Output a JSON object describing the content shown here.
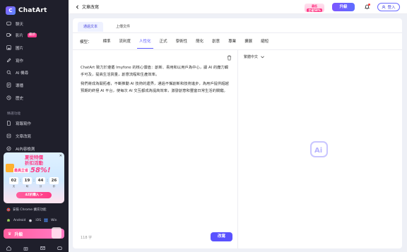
{
  "sidebar": {
    "brand": "ChatArt",
    "nav": [
      {
        "label": "聊天",
        "icon": "chat-icon"
      },
      {
        "label": "影片",
        "icon": "video-icon",
        "badge": "最新"
      },
      {
        "label": "圖片",
        "icon": "image-icon"
      },
      {
        "label": "寫作",
        "icon": "pen-icon"
      },
      {
        "label": "AI 機尋",
        "icon": "ai-search-icon"
      },
      {
        "label": "導播",
        "icon": "broadcast-icon"
      },
      {
        "label": "歷史",
        "icon": "history-icon"
      }
    ],
    "section_label": "精選功能",
    "tools": [
      {
        "label": "寫報寫作",
        "icon": "document-icon"
      },
      {
        "label": "文章改寫",
        "icon": "rewrite-icon"
      },
      {
        "label": "AI內容檢測",
        "icon": "detect-icon"
      }
    ],
    "promo": {
      "title_line1": "夏從特價",
      "title_line2": "折扣活動",
      "up_to": "最高立省",
      "percent": "58%!",
      "countdown": [
        {
          "value": "02",
          "unit": "天"
        },
        {
          "value": "19",
          "unit": "時"
        },
        {
          "value": "44",
          "unit": "分"
        },
        {
          "value": "26",
          "unit": "秒"
        }
      ],
      "cta": "4Z折購入 >"
    },
    "chrome_ext": "安裝 Chrome 擴充功能",
    "platforms": [
      "Android",
      "iOS",
      "Win"
    ],
    "upgrade": "升級"
  },
  "header": {
    "back_label": "文章改寫",
    "sale_chip": {
      "line1": "最低",
      "tag": "立省58%"
    },
    "upgrade": "升級",
    "login": "登入"
  },
  "panel": {
    "tabs": [
      "通過文本",
      "上傳文件"
    ],
    "active_tab": 0,
    "model_label": "模型：",
    "models": [
      "標準",
      "流利度",
      "人性化",
      "正式",
      "學術性",
      "簡化",
      "創意",
      "專業",
      "擴展",
      "縮短"
    ],
    "active_model": 2,
    "text_paragraphs": [
      "ChatArt 致力於遵循 Imyfone 的核心價值：創新、易用和以用戶為中心，讓 AI 的魔力觸手可及，提高生活質量，創意流程和生產效率。",
      "我們將成為開拓者，不斷推動 AI 技術的邊界，通過不懈創新和技術進步，為用戶提供超越預期的終極 AI 平台，使每次 AI 交互都成為提高效率，激發創意和豐富日常生活的關鍵。"
    ],
    "char_count": "118 字",
    "rewrite_button": "改寫",
    "output_language": "繁體中文"
  },
  "colors": {
    "accent": "#5a52ff",
    "pink": "#ff3a86",
    "sidebar_bg": "#1f1f2b"
  }
}
